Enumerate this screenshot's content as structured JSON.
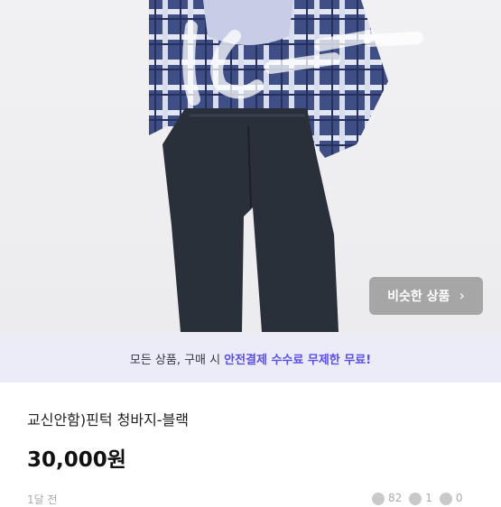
{
  "similar_button": {
    "label": "비슷한 상품",
    "chevron": "›"
  },
  "banner": {
    "text_prefix": "모든 상품, 구매 시",
    "text_highlight": "안전결제 수수료 무제한 무료!"
  },
  "product": {
    "title": "교신안함)핀턱 청바지-블랙",
    "price": "30,000원",
    "posted": "1달 전"
  },
  "stats": {
    "views": "82",
    "likes": "1",
    "chats": "0"
  },
  "colors": {
    "accent": "#5a4ee8",
    "banner_bg": "#ececf8"
  }
}
